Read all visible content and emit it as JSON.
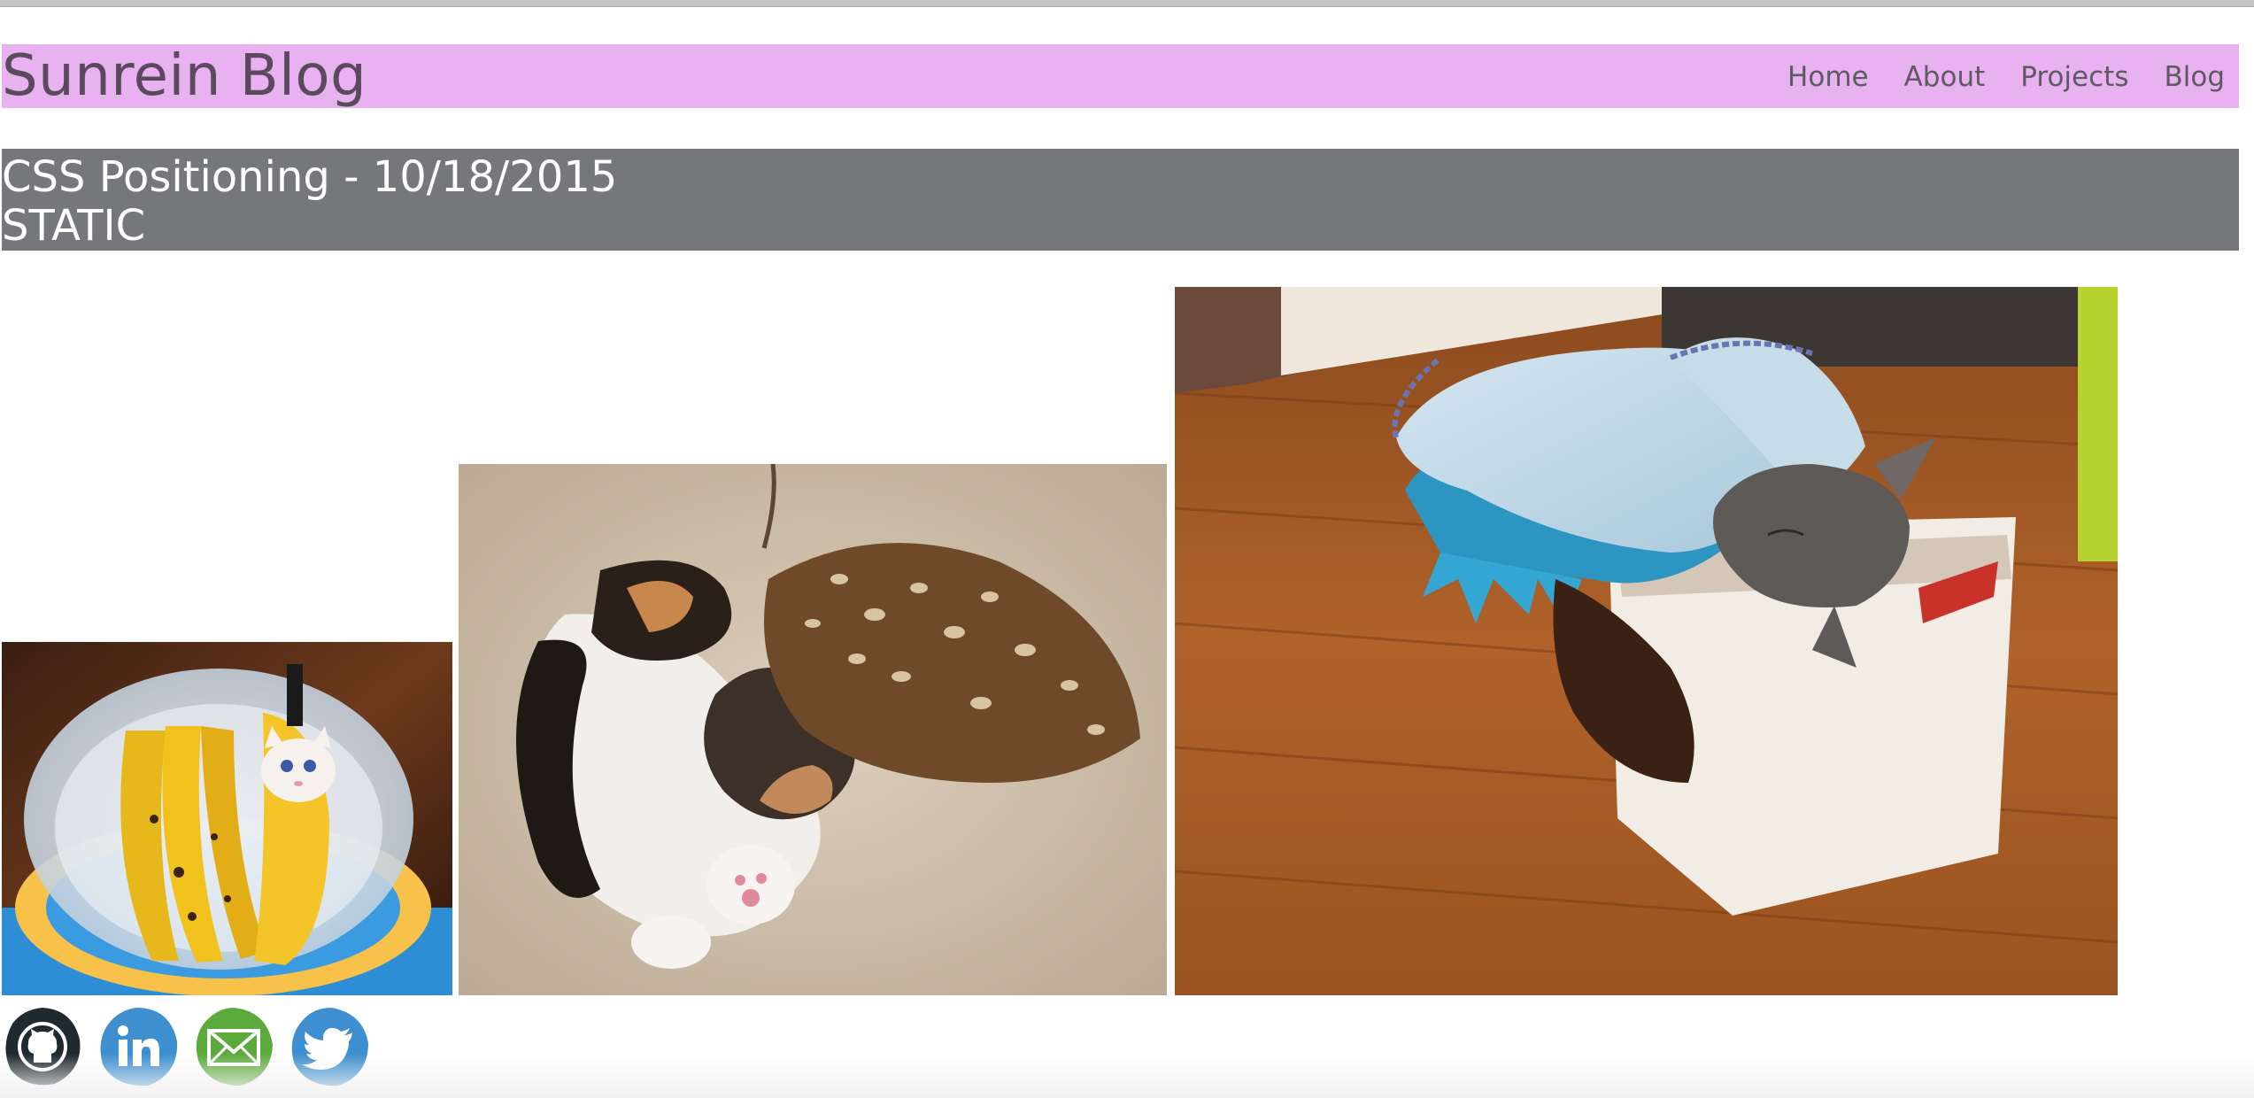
{
  "header": {
    "site_title": "Sunrein Blog",
    "nav": [
      "Home",
      "About",
      "Projects",
      "Blog"
    ],
    "background": "#e8b1f0"
  },
  "post": {
    "title": "CSS Positioning - 10/18/2015",
    "subtitle": "STATIC",
    "banner_color": "#76777b"
  },
  "images": [
    {
      "alt": "kitten-in-banana-bowl"
    },
    {
      "alt": "kitten-sleeping-with-owl"
    },
    {
      "alt": "kitten-wrapped-in-blanket-in-box"
    }
  ],
  "social": [
    {
      "name": "github",
      "color": "#1e2a2e"
    },
    {
      "name": "linkedin",
      "color": "#3d8fd0"
    },
    {
      "name": "email",
      "color": "#5daa3c"
    },
    {
      "name": "twitter",
      "color": "#3d8fd0"
    }
  ]
}
